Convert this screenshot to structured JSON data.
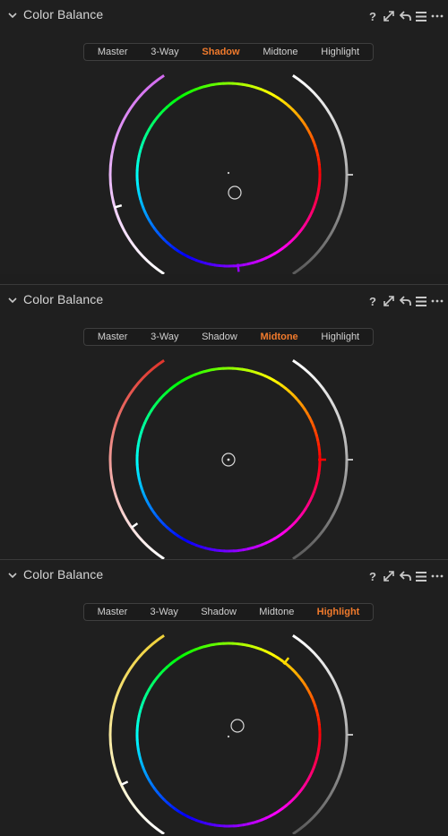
{
  "panels": [
    {
      "title": "Color Balance",
      "tabs": [
        "Master",
        "3-Way",
        "Shadow",
        "Midtone",
        "Highlight"
      ],
      "active_tab": "Shadow",
      "left_arc_hue": "magenta",
      "left_arc_color": "#d36bf0",
      "puck_visible": true,
      "icons": [
        "help-icon",
        "popout-icon",
        "reset-icon",
        "menu-icon",
        "more-icon"
      ]
    },
    {
      "title": "Color Balance",
      "tabs": [
        "Master",
        "3-Way",
        "Shadow",
        "Midtone",
        "Highlight"
      ],
      "active_tab": "Midtone",
      "left_arc_hue": "red",
      "left_arc_color": "#e0352c",
      "puck_visible": true,
      "icons": [
        "help-icon",
        "popout-icon",
        "reset-icon",
        "menu-icon",
        "more-icon"
      ]
    },
    {
      "title": "Color Balance",
      "tabs": [
        "Master",
        "3-Way",
        "Shadow",
        "Midtone",
        "Highlight"
      ],
      "active_tab": "Highlight",
      "left_arc_hue": "yellow",
      "left_arc_color": "#f0d23a",
      "puck_visible": true,
      "icons": [
        "help-icon",
        "popout-icon",
        "reset-icon",
        "menu-icon",
        "more-icon"
      ]
    }
  ],
  "colors": {
    "accent": "#f07a2c",
    "background": "#1f1f1f",
    "text": "#d4d4d4"
  }
}
